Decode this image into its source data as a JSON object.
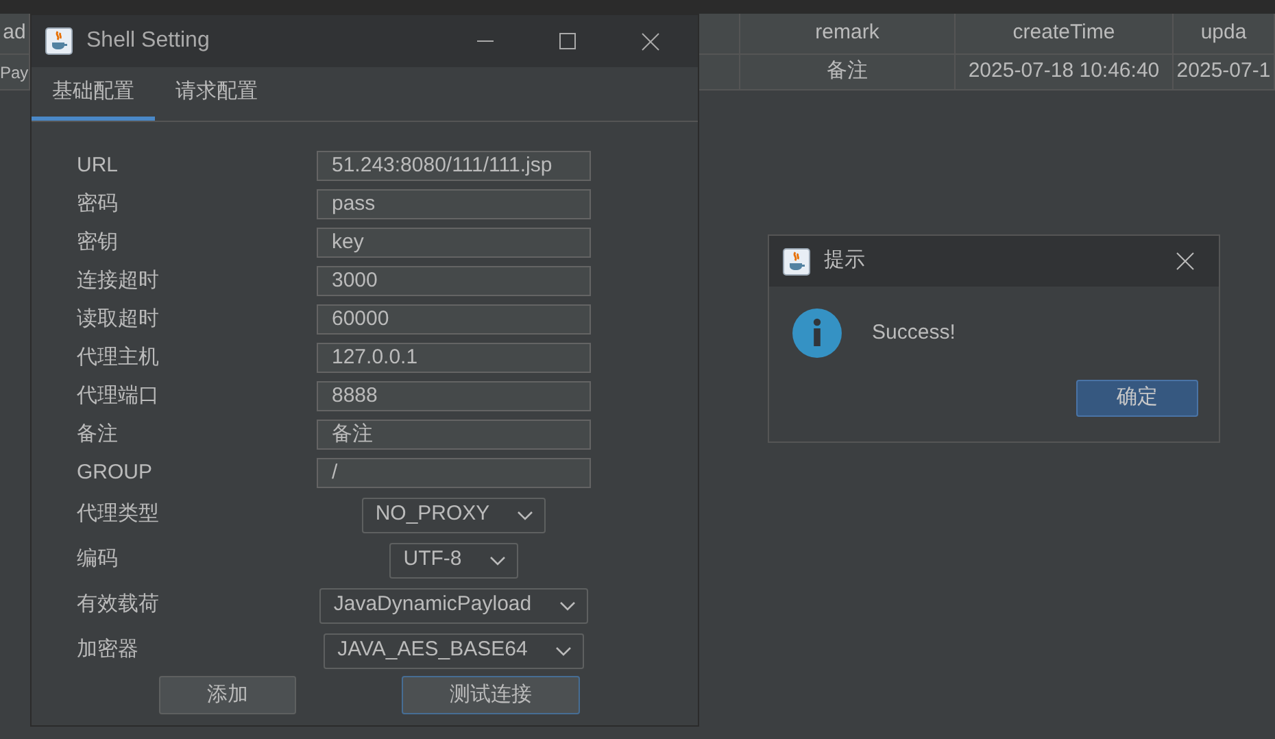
{
  "table": {
    "columns": [
      "ad",
      "remark",
      "createTime",
      "upda"
    ],
    "rows": [
      [
        "Pay",
        "备注",
        "2025-07-18 10:46:40",
        "2025-07-1"
      ]
    ]
  },
  "window": {
    "title": "Shell Setting"
  },
  "tabs": [
    {
      "label": "基础配置",
      "selected": true
    },
    {
      "label": "请求配置",
      "selected": false
    }
  ],
  "fields": [
    {
      "kind": "text",
      "label": "URL",
      "value": "51.243:8080/111/111.jsp"
    },
    {
      "kind": "text",
      "label": "密码",
      "value": "pass"
    },
    {
      "kind": "text",
      "label": "密钥",
      "value": "key"
    },
    {
      "kind": "text",
      "label": "连接超时",
      "value": "3000"
    },
    {
      "kind": "text",
      "label": "读取超时",
      "value": "60000"
    },
    {
      "kind": "text",
      "label": "代理主机",
      "value": "127.0.0.1"
    },
    {
      "kind": "text",
      "label": "代理端口",
      "value": "8888"
    },
    {
      "kind": "text",
      "label": "备注",
      "value": "备注"
    },
    {
      "kind": "text",
      "label": "GROUP",
      "value": "/"
    },
    {
      "kind": "select",
      "label": "代理类型",
      "value": "NO_PROXY"
    },
    {
      "kind": "select",
      "label": "编码",
      "value": "UTF-8"
    },
    {
      "kind": "select",
      "label": "有效载荷",
      "value": "JavaDynamicPayload"
    },
    {
      "kind": "select",
      "label": "加密器",
      "value": "JAVA_AES_BASE64"
    }
  ],
  "buttons": [
    {
      "label": "添加",
      "focused": false
    },
    {
      "label": "测试连接",
      "focused": true
    }
  ],
  "dialog": {
    "title": "提示",
    "message": "Success!",
    "button": "确定"
  }
}
